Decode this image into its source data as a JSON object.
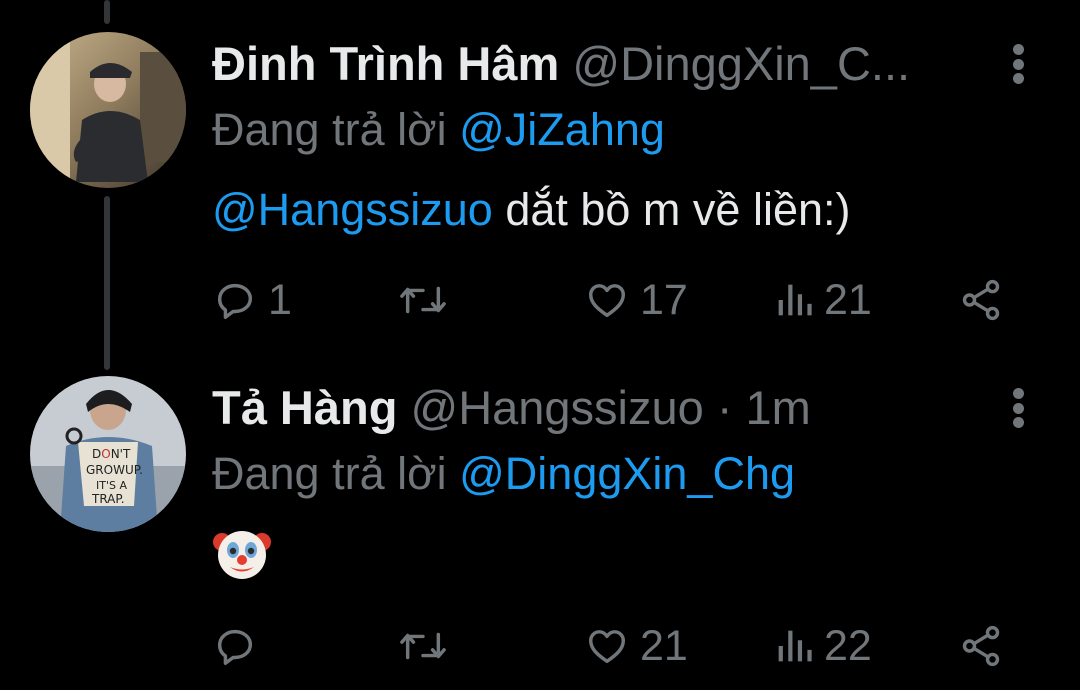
{
  "tweets": [
    {
      "name": "Đinh Trình Hâm",
      "handle": "@DinggXin_C...",
      "reply_prefix": "Đang trả lời",
      "reply_to": "@JiZahng",
      "body_mention": "@Hangssizuo",
      "body_text": " dắt bồ m về liền:)",
      "actions": {
        "reply": "1",
        "retweet": "",
        "like": "17",
        "views": "21"
      }
    },
    {
      "name": "Tả Hàng",
      "handle": "@Hangssizuo · 1m",
      "reply_prefix": "Đang trả lời",
      "reply_to": "@DinggXin_Chg",
      "emoji": "clown-face-emoji",
      "actions": {
        "reply": "",
        "retweet": "",
        "like": "21",
        "views": "22"
      }
    }
  ],
  "colors": {
    "background": "#000000",
    "text": "#e7e9ea",
    "secondary": "#71767b",
    "link": "#1d9bf0",
    "thread_line": "#333639"
  },
  "icons": [
    "reply-icon",
    "retweet-icon",
    "like-icon",
    "views-icon",
    "share-icon",
    "more-icon"
  ]
}
